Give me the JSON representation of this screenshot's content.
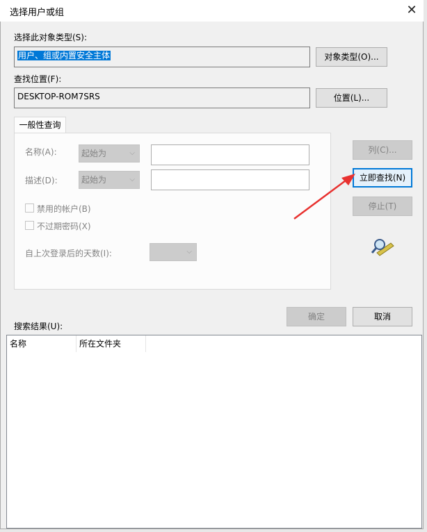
{
  "window": {
    "title": "选择用户或组",
    "close_glyph": "✕"
  },
  "object_type": {
    "label": "选择此对象类型(S):",
    "value": "用户、组或内置安全主体",
    "button": "对象类型(O)..."
  },
  "location": {
    "label": "查找位置(F):",
    "value": "DESKTOP-ROM7SRS",
    "button": "位置(L)..."
  },
  "general_query": {
    "tab": "一般性查询",
    "name_label": "名称(A):",
    "name_mode": "起始为",
    "desc_label": "描述(D):",
    "desc_mode": "起始为",
    "disabled_accounts": "禁用的帐户(B)",
    "non_expiring": "不过期密码(X)",
    "days_label": "自上次登录后的天数(I):",
    "combo_arrow": "⌵"
  },
  "side_buttons": {
    "columns": "列(C)...",
    "find_now": "立即查找(N)",
    "stop": "停止(T)"
  },
  "dialog_buttons": {
    "ok": "确定",
    "cancel": "取消"
  },
  "results": {
    "label": "搜索结果(U):",
    "columns": [
      "名称",
      "所在文件夹"
    ]
  },
  "colors": {
    "accent": "#0078d7",
    "annotation_arrow": "#e8312f"
  },
  "icons": {
    "search_users": "magnifier-icon",
    "close": "close-icon"
  }
}
